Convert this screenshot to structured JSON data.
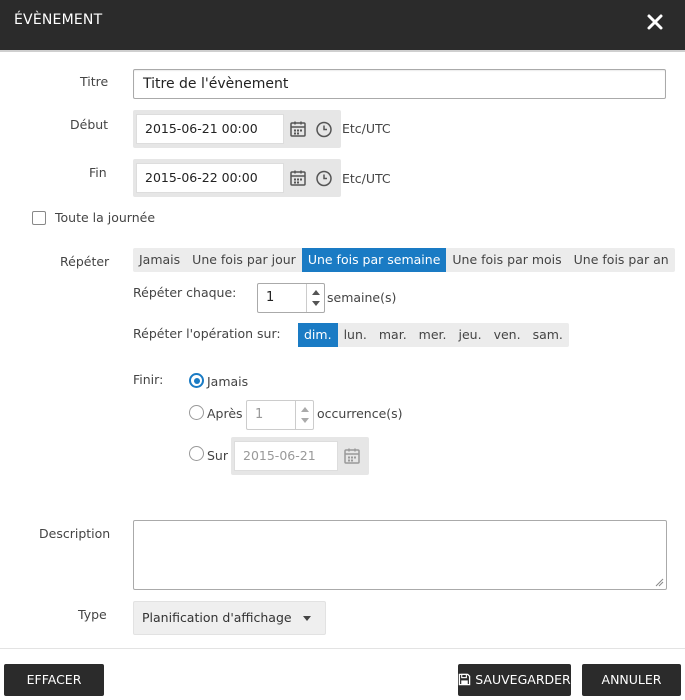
{
  "dialog": {
    "title": "ÉVÈNEMENT",
    "close_icon": "close-icon"
  },
  "form": {
    "title_label": "Titre",
    "title_value": "Titre de l'évènement",
    "start_label": "Début",
    "start_value": "2015-06-21 00:00",
    "end_label": "Fin",
    "end_value": "2015-06-22 00:00",
    "timezone": "Etc/UTC",
    "all_day_label": "Toute la journée",
    "all_day_checked": false,
    "repeat_label": "Répéter",
    "repeat_options": [
      "Jamais",
      "Une fois par jour",
      "Une fois par semaine",
      "Une fois par mois",
      "Une fois par an"
    ],
    "repeat_selected": "Une fois par semaine",
    "repeat_every_label": "Répéter chaque:",
    "repeat_every_value": "1",
    "repeat_every_unit": "semaine(s)",
    "repeat_on_label": "Répéter l'opération sur:",
    "days": [
      "dim.",
      "lun.",
      "mar.",
      "mer.",
      "jeu.",
      "ven.",
      "sam."
    ],
    "days_selected": "dim.",
    "end_repeat_label": "Finir:",
    "end_never_label": "Jamais",
    "end_after_label": "Après",
    "end_after_value": "1",
    "end_after_unit": "occurrence(s)",
    "end_on_label": "Sur",
    "end_on_value": "2015-06-21",
    "end_selected": "Jamais",
    "description_label": "Description",
    "description_value": "",
    "type_label": "Type",
    "type_value": "Planification d'affichage"
  },
  "footer": {
    "clear_label": "EFFACER",
    "save_label": "SAUVEGARDER",
    "cancel_label": "ANNULER"
  },
  "colors": {
    "header_bg": "#2b2b2b",
    "accent": "#1a7bc4",
    "button_bg": "#2b2b2b"
  }
}
